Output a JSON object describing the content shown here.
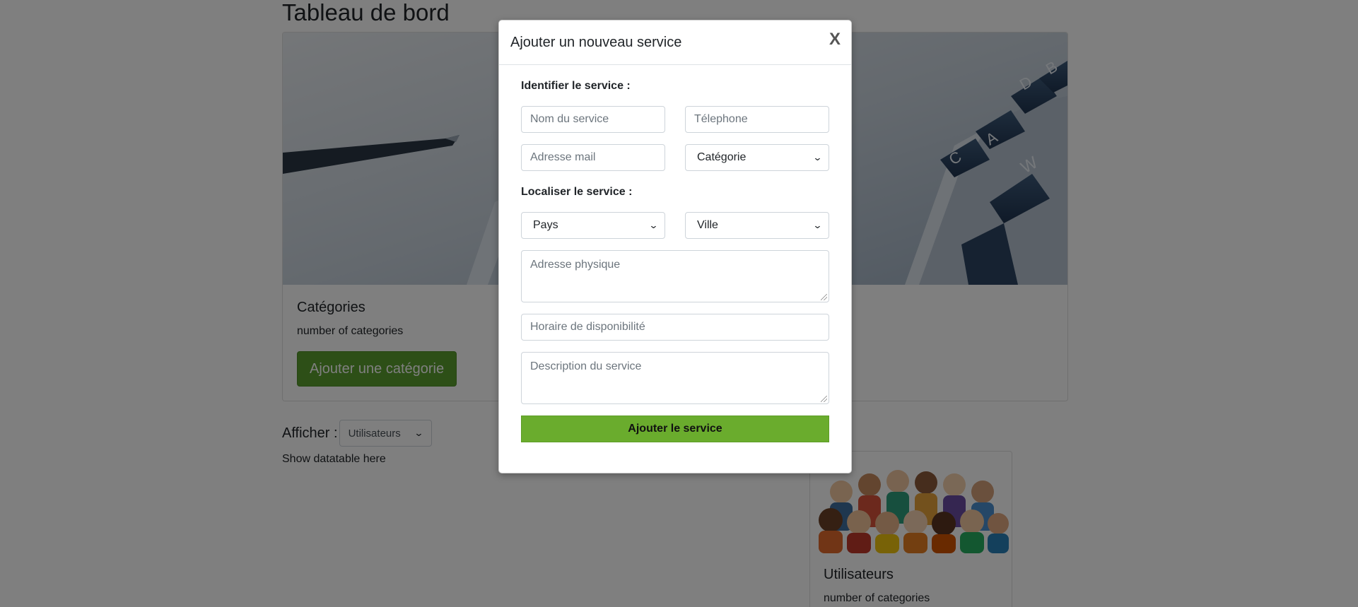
{
  "page": {
    "title": "Tableau de bord"
  },
  "categories_card": {
    "title": "Catégories",
    "text": "number of categories",
    "button_label": "Ajouter une catégorie"
  },
  "display": {
    "label": "Afficher :",
    "selected": "Utilisateurs",
    "datatable_note": "Show datatable here"
  },
  "users_card": {
    "title": "Utilisateurs",
    "text": "number of categories"
  },
  "modal": {
    "title": "Ajouter un nouveau service",
    "close_label": "X",
    "section_identify": "Identifier le service :",
    "service_name_placeholder": "Nom du service",
    "phone_placeholder": "Télephone",
    "email_placeholder": "Adresse mail",
    "category_selected": "Catégorie",
    "section_locate": "Localiser le service :",
    "country_selected": "Pays",
    "city_selected": "Ville",
    "address_placeholder": "Adresse physique",
    "hours_placeholder": "Horaire de disponibilité",
    "description_placeholder": "Description du service",
    "submit_label": "Ajouter le service"
  },
  "colors": {
    "accent_green": "#6aac2d",
    "button_green": "#5a9e2f",
    "backdrop": "rgba(0,0,0,0.5)"
  }
}
